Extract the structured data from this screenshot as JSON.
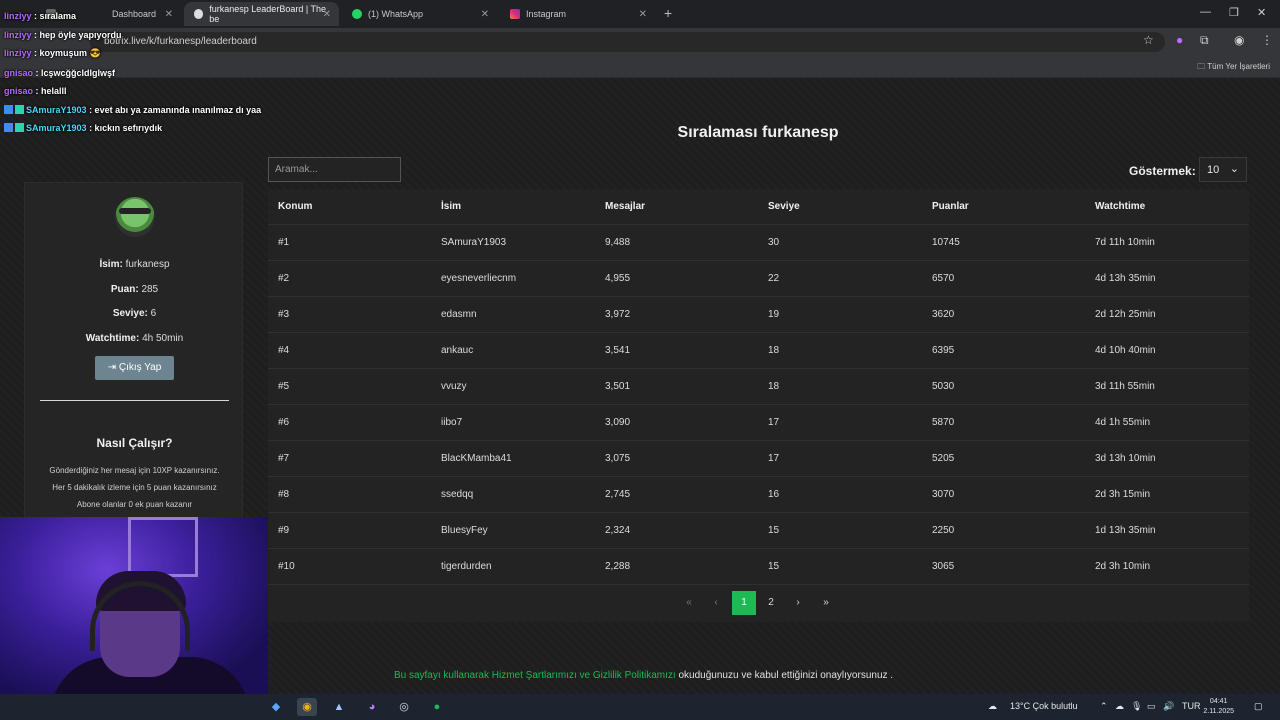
{
  "browser": {
    "tabs": [
      {
        "title": "Dashboard",
        "active": false
      },
      {
        "title": "furkanesp LeaderBoard | The be",
        "active": true
      },
      {
        "title": "(1) WhatsApp",
        "active": false
      },
      {
        "title": "Instagram",
        "active": false
      }
    ],
    "url": "botrix.live/k/furkanesp/leaderboard",
    "bookmarks_label": "Tüm Yer İşaretleri"
  },
  "page": {
    "heading": "Sıralaması furkanesp",
    "search_placeholder": "Aramak...",
    "show_label": "Göstermek:",
    "show_value": "10",
    "table": {
      "headers": [
        "Konum",
        "İsim",
        "Mesajlar",
        "Seviye",
        "Puanlar",
        "Watchtime"
      ],
      "rows": [
        [
          "#1",
          "SAmuraY1903",
          "9,488",
          "30",
          "10745",
          "7d 11h 10min"
        ],
        [
          "#2",
          "eyesneverliecnm",
          "4,955",
          "22",
          "6570",
          "4d 13h 35min"
        ],
        [
          "#3",
          "edasmn",
          "3,972",
          "19",
          "3620",
          "2d 12h 25min"
        ],
        [
          "#4",
          "ankauc",
          "3,541",
          "18",
          "6395",
          "4d 10h 40min"
        ],
        [
          "#5",
          "vvuzy",
          "3,501",
          "18",
          "5030",
          "3d 11h 55min"
        ],
        [
          "#6",
          "iibo7",
          "3,090",
          "17",
          "5870",
          "4d 1h 55min"
        ],
        [
          "#7",
          "BlacKMamba41",
          "3,075",
          "17",
          "5205",
          "3d 13h 10min"
        ],
        [
          "#8",
          "ssedqq",
          "2,745",
          "16",
          "3070",
          "2d 3h 15min"
        ],
        [
          "#9",
          "BluesyFey",
          "2,324",
          "15",
          "2250",
          "1d 13h 35min"
        ],
        [
          "#10",
          "tigerdurden",
          "2,288",
          "15",
          "3065",
          "2d 3h 10min"
        ]
      ]
    },
    "pagination": {
      "first": "«",
      "prev": "‹",
      "pages": [
        "1",
        "2"
      ],
      "next": "›",
      "last": "»"
    },
    "profile": {
      "name_label": "İsim:",
      "name": "furkanesp",
      "points_label": "Puan:",
      "points": "285",
      "level_label": "Seviye:",
      "level": "6",
      "watchtime_label": "Watchtime:",
      "watchtime": "4h 50min",
      "logout": "Çıkış Yap",
      "how_title": "Nasıl Çalışır?",
      "how_lines": [
        "Gönderdiğiniz her mesaj için 10XP kazanırsınız.",
        "Her 5 dakikalık izleme için 5 puan kazanırsınız",
        "Abone olanlar 0 ek puan kazanır"
      ]
    },
    "footer": {
      "prefix": "Bu sayfayı kullanarak ",
      "terms": "Hizmet Şartlarımızı",
      "and": " ve ",
      "privacy": "Gizlilik Politikamızı",
      "suffix": " okuduğunuzu ve kabul ettiğinizi onaylıyorsunuz ."
    }
  },
  "chat": [
    {
      "user": "linziyy",
      "text": ": sıralama"
    },
    {
      "user": "linziyy",
      "text": ": hep öyle yapıyordu"
    },
    {
      "user": "linziyy",
      "text": ": koymuşum 😎"
    },
    {
      "user": "gnisao",
      "text": ": lcşwcğğcldlglwşf"
    },
    {
      "user": "gnisao",
      "text": ": helalll"
    },
    {
      "user": "SAmuraY1903",
      "text": ": evet abı ya zamanında ınanılmaz dı yaa"
    },
    {
      "user": "SAmuraY1903",
      "text": ": kıckın sefırıydık"
    }
  ],
  "taskbar": {
    "weather": "13°C  Çok bulutlu",
    "lang": "TUR",
    "time": "04:41",
    "date": "2.11.2025"
  },
  "colors": {
    "accent": "#1db954",
    "logout_button": "#6c8591"
  }
}
